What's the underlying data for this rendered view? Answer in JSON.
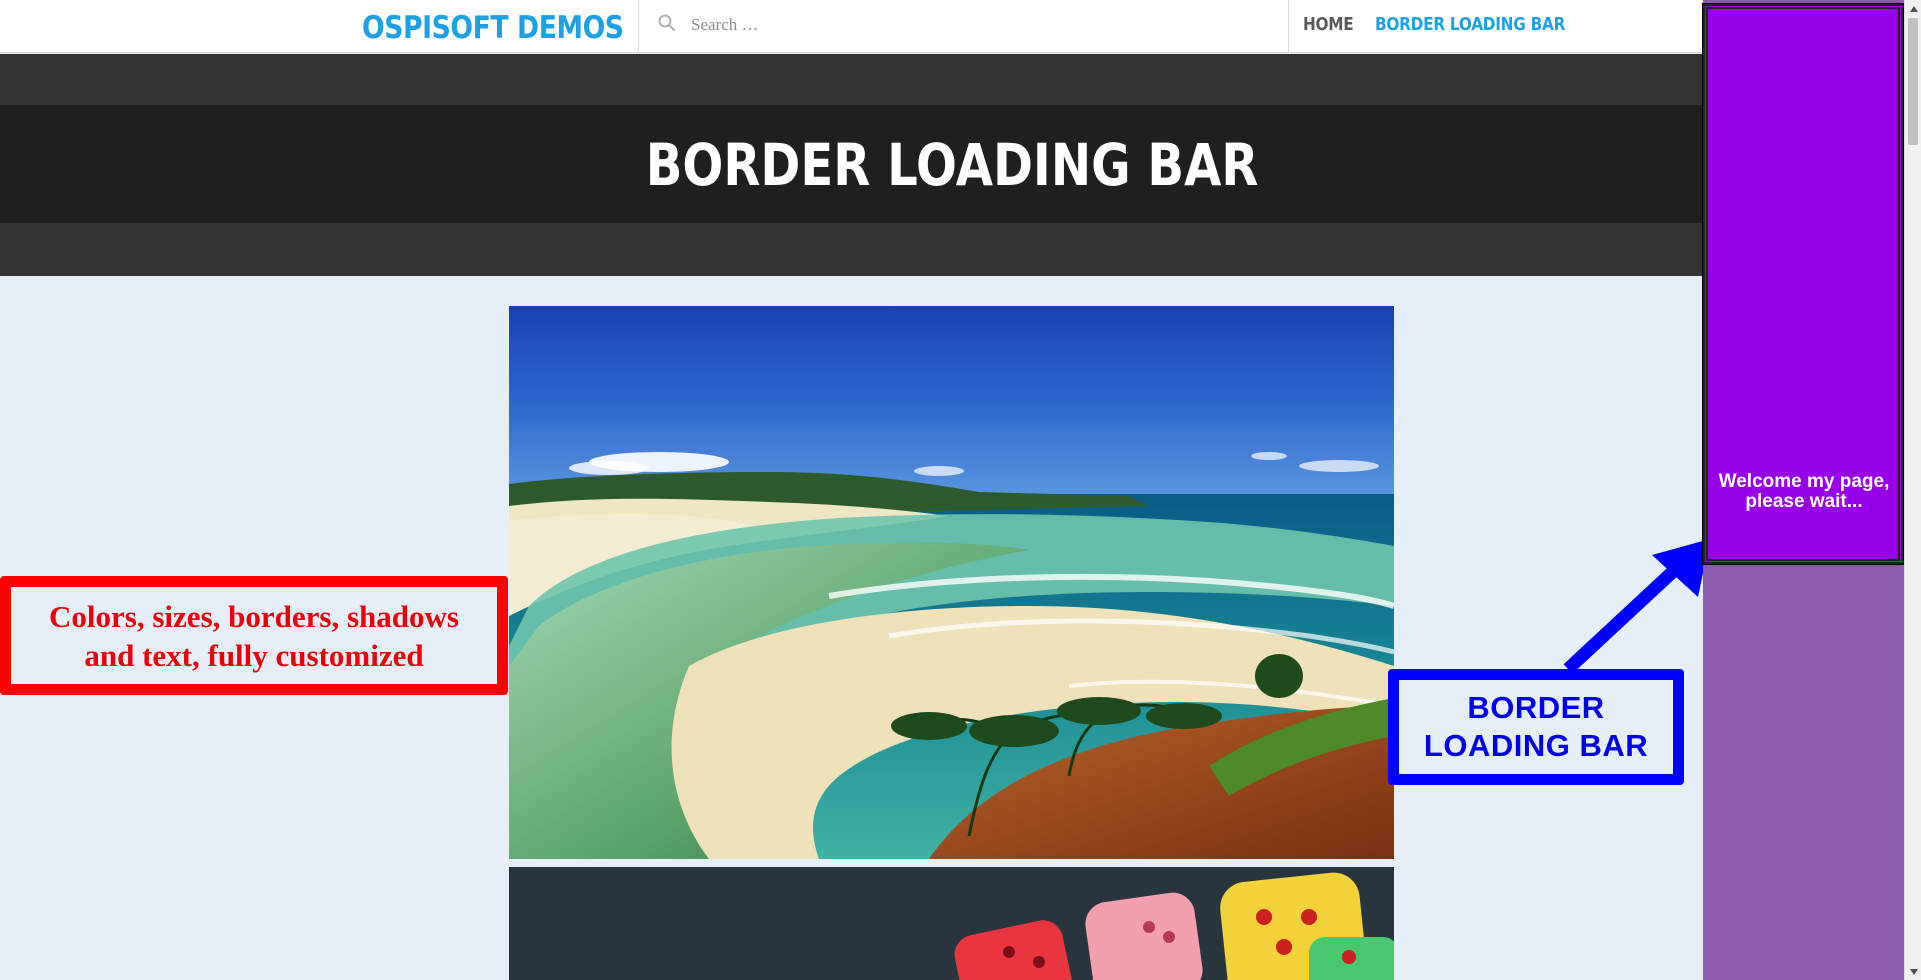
{
  "header": {
    "brand": "OSPISOFT DEMOS",
    "search_placeholder": "Search …",
    "nav": [
      {
        "label": "HOME"
      },
      {
        "label": "BORDER LOADING BAR"
      }
    ]
  },
  "hero": {
    "title": "BORDER LOADING BAR"
  },
  "callouts": {
    "left_line1": "Colors, sizes, borders, shadows",
    "left_line2": "and text, fully customized",
    "right_line1": "BORDER",
    "right_line2": "LOADING BAR"
  },
  "loader": {
    "text_line1": "Welcome my page,",
    "text_line2": "please wait..."
  },
  "colors": {
    "brand": "#1ea0e6",
    "loader_fill": "#9900ea",
    "loader_track": "#8e5cae",
    "callout_left": "#ff0000",
    "callout_right": "#0000ff"
  },
  "icons": {
    "search": "search-icon",
    "scroll_up": "chevron-up-icon",
    "scroll_down": "chevron-down-icon"
  }
}
